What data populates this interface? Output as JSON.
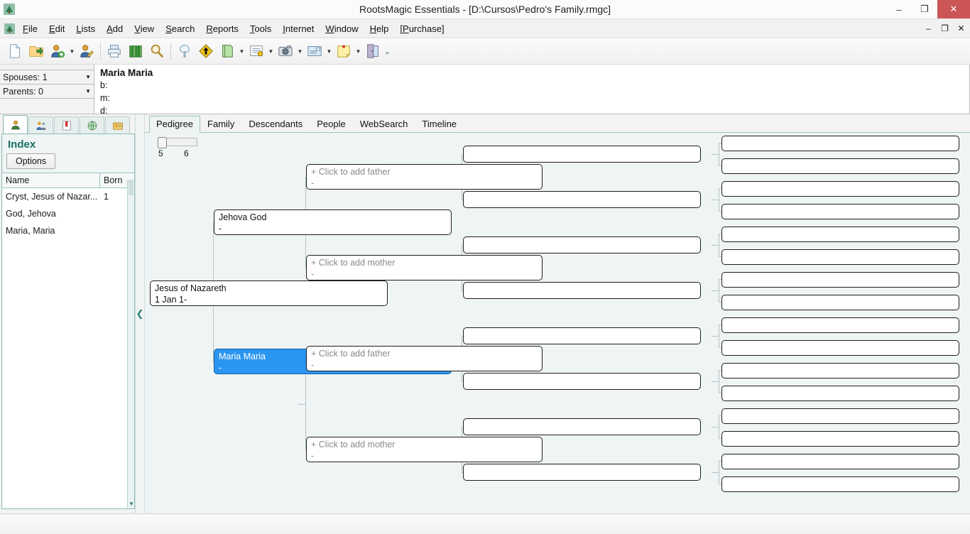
{
  "window": {
    "title": "RootsMagic Essentials - [D:\\Cursos\\Pedro's Family.rmgc]",
    "app_icon": "tree-icon",
    "minimize": "–",
    "restore": "❐",
    "close": "✕"
  },
  "mdi": {
    "minimize": "–",
    "restore": "❐",
    "close": "✕"
  },
  "menu": [
    {
      "label": "File",
      "accel": "F"
    },
    {
      "label": "Edit",
      "accel": "E"
    },
    {
      "label": "Lists",
      "accel": "L"
    },
    {
      "label": "Add",
      "accel": "A"
    },
    {
      "label": "View",
      "accel": "V"
    },
    {
      "label": "Search",
      "accel": "S"
    },
    {
      "label": "Reports",
      "accel": "R"
    },
    {
      "label": "Tools",
      "accel": "T"
    },
    {
      "label": "Internet",
      "accel": "I"
    },
    {
      "label": "Window",
      "accel": "W"
    },
    {
      "label": "Help",
      "accel": "H"
    },
    {
      "label": "[Purchase]",
      "accel": "P"
    }
  ],
  "toolbar": [
    {
      "name": "new-file-icon",
      "caret": false
    },
    {
      "name": "open-file-icon",
      "caret": false
    },
    {
      "name": "add-person-icon",
      "caret": true
    },
    {
      "name": "edit-person-icon",
      "caret": false
    },
    {
      "name": "print-icon",
      "caret": false
    },
    {
      "name": "books-icon",
      "caret": false
    },
    {
      "name": "search-icon",
      "caret": false
    },
    {
      "name": "family-tree-icon",
      "caret": false
    },
    {
      "name": "navigate-sign-icon",
      "caret": false
    },
    {
      "name": "notes-icon",
      "caret": true
    },
    {
      "name": "sources-icon",
      "caret": true
    },
    {
      "name": "media-camera-icon",
      "caret": true
    },
    {
      "name": "report-mail-icon",
      "caret": true
    },
    {
      "name": "todo-note-icon",
      "caret": true
    },
    {
      "name": "exit-door-icon",
      "caret": false
    },
    {
      "name": "more-chevron-icon",
      "caret": false
    }
  ],
  "stats": {
    "spouses": {
      "label": "Spouses: 1",
      "arrow": "▼"
    },
    "parents": {
      "label": "Parents: 0",
      "arrow": "▼"
    }
  },
  "info": {
    "name": "Maria Maria",
    "birth": "b:",
    "marriage": "m:",
    "death": "d:"
  },
  "sidetabs": [
    {
      "name": "person-tab",
      "icon": "person-icon"
    },
    {
      "name": "family-tab",
      "icon": "couple-icon"
    },
    {
      "name": "bookmarks-tab",
      "icon": "book-icon"
    },
    {
      "name": "web-tab",
      "icon": "globe-icon"
    },
    {
      "name": "group-tab",
      "icon": "group-icon"
    }
  ],
  "index": {
    "title": "Index",
    "options_label": "Options",
    "columns": [
      "Name",
      "Born"
    ],
    "rows": [
      {
        "name": "Cryst, Jesus of Nazar...",
        "born": "1"
      },
      {
        "name": "God, Jehova",
        "born": ""
      },
      {
        "name": "Maria, Maria",
        "born": ""
      }
    ]
  },
  "splitter": {
    "collapse_icon": "❮"
  },
  "tabs": [
    {
      "label": "Pedigree",
      "active": true
    },
    {
      "label": "Family",
      "active": false
    },
    {
      "label": "Descendants",
      "active": false
    },
    {
      "label": "People",
      "active": false
    },
    {
      "label": "WebSearch",
      "active": false
    },
    {
      "label": "Timeline",
      "active": false
    }
  ],
  "generations_slider": {
    "value": 5,
    "ticks": [
      "5",
      "6"
    ]
  },
  "pedigree": {
    "root": {
      "line1": "Jesus of Nazareth",
      "line2": "1 Jan 1-"
    },
    "father": {
      "line1": "Jehova God",
      "line2": "-"
    },
    "mother": {
      "line1": "Maria Maria",
      "line2": "-",
      "selected": true
    },
    "add_father_label": "+ Click to add father",
    "add_mother_label": "+ Click to add mother",
    "placeholder_dash": "-",
    "gen3": [
      {
        "type": "add-father",
        "line1": "+ Click to add father",
        "line2": "-"
      },
      {
        "type": "add-mother",
        "line1": "+ Click to add mother",
        "line2": "-"
      },
      {
        "type": "add-father",
        "line1": "+ Click to add father",
        "line2": "-"
      },
      {
        "type": "add-mother",
        "line1": "+ Click to add mother",
        "line2": "-"
      }
    ],
    "gen4_count": 8,
    "gen5_count": 16
  },
  "colors": {
    "selection_blue": "#2b96f1",
    "index_title_teal": "#1a6e63",
    "pedigree_bg": "#eff4f4",
    "close_button_red": "#cc5555"
  }
}
